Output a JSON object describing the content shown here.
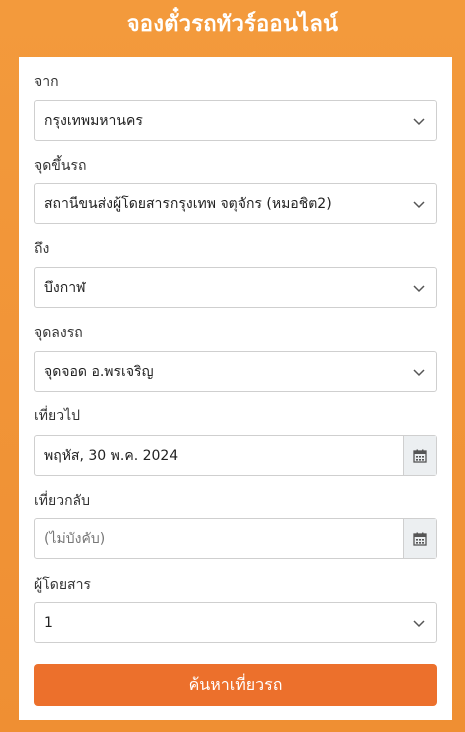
{
  "header": {
    "title": "จองตั๋วรถทัวร์ออนไลน์"
  },
  "form": {
    "from": {
      "label": "จาก",
      "value": "กรุงเทพมหานคร"
    },
    "pickup": {
      "label": "จุดขึ้นรถ",
      "value": "สถานีขนส่งผู้โดยสารกรุงเทพ จตุจักร (หมอชิต2)"
    },
    "to": {
      "label": "ถึง",
      "value": "บึงกาฬ"
    },
    "dropoff": {
      "label": "จุดลงรถ",
      "value": "จุดจอด อ.พรเจริญ"
    },
    "depart": {
      "label": "เที่ยวไป",
      "value": "พฤหัส, 30 พ.ค. 2024"
    },
    "return": {
      "label": "เที่ยวกลับ",
      "placeholder": "(ไม่บังคับ)"
    },
    "passengers": {
      "label": "ผู้โดยสาร",
      "value": "1"
    },
    "submit_label": "ค้นหาเที่ยวรถ"
  },
  "colors": {
    "background": "#f39a3c",
    "button": "#ec702c"
  },
  "icons": {
    "dropdown": "chevron-down-icon",
    "date": "calendar-icon"
  }
}
